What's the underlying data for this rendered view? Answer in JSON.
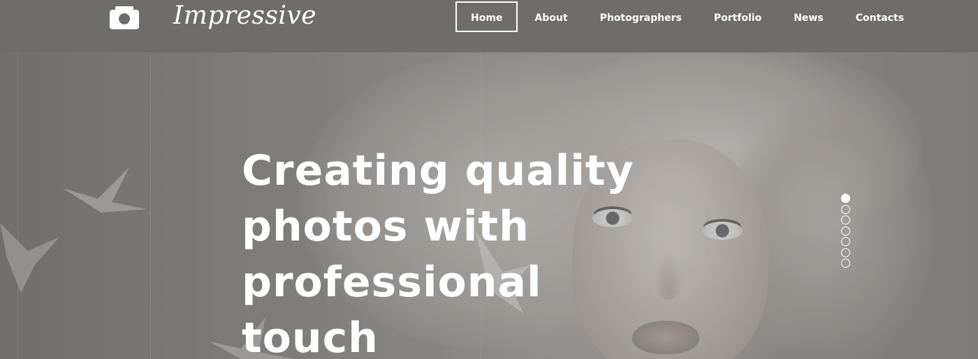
{
  "brand": {
    "name": "Impressive",
    "icon": "camera-icon"
  },
  "nav": {
    "items": [
      {
        "label": "Home",
        "active": true
      },
      {
        "label": "About",
        "active": false
      },
      {
        "label": "Photographers",
        "active": false
      },
      {
        "label": "Portfolio",
        "active": false
      },
      {
        "label": "News",
        "active": false
      },
      {
        "label": "Contacts",
        "active": false
      }
    ]
  },
  "hero": {
    "title_lines": [
      "Creating quality",
      "photos with",
      "professional touch"
    ]
  },
  "slider": {
    "total_slides": 7,
    "active_index": 0
  },
  "colors": {
    "header_bg": "#6e6d6c",
    "text": "#ffffff"
  }
}
